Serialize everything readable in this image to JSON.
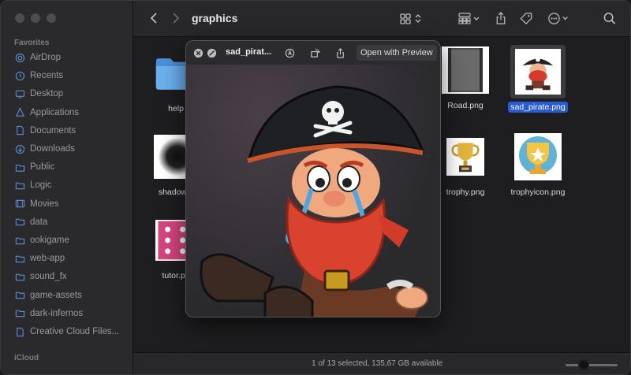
{
  "sidebar": {
    "favorites_label": "Favorites",
    "icloud_label": "iCloud",
    "items": [
      {
        "label": "AirDrop",
        "icon": "airdrop-icon"
      },
      {
        "label": "Recents",
        "icon": "clock-icon"
      },
      {
        "label": "Desktop",
        "icon": "desktop-icon"
      },
      {
        "label": "Applications",
        "icon": "applications-icon"
      },
      {
        "label": "Documents",
        "icon": "document-icon"
      },
      {
        "label": "Downloads",
        "icon": "download-icon"
      },
      {
        "label": "Public",
        "icon": "public-icon"
      },
      {
        "label": "Logic",
        "icon": "folder-icon"
      },
      {
        "label": "Movies",
        "icon": "movies-icon"
      },
      {
        "label": "data",
        "icon": "folder-icon"
      },
      {
        "label": "ookigame",
        "icon": "folder-icon"
      },
      {
        "label": "web-app",
        "icon": "folder-icon"
      },
      {
        "label": "sound_fx",
        "icon": "folder-icon"
      },
      {
        "label": "game-assets",
        "icon": "folder-icon"
      },
      {
        "label": "dark-infernos",
        "icon": "folder-icon"
      },
      {
        "label": "Creative Cloud Files...",
        "icon": "document-icon"
      }
    ]
  },
  "toolbar": {
    "title": "graphics"
  },
  "files": [
    {
      "name": "help",
      "kind": "folder"
    },
    {
      "name": "Road.png",
      "kind": "road"
    },
    {
      "name": "sad_pirate.png",
      "kind": "pirate",
      "selected": true
    },
    {
      "name": "shadow.p",
      "kind": "shadow"
    },
    {
      "name": "trophy.png",
      "kind": "trophy"
    },
    {
      "name": "trophyicon.png",
      "kind": "trophyicon"
    },
    {
      "name": "tutor.pn",
      "kind": "tutor"
    }
  ],
  "quicklook": {
    "title": "sad_pirat...",
    "open_label": "Open with Preview"
  },
  "status": {
    "text": "1 of 13 selected, 135,67 GB available"
  },
  "colors": {
    "selection": "#2a5bd7",
    "folder": "#5ba4e6",
    "sidebar_icon": "#5b8ed8"
  }
}
